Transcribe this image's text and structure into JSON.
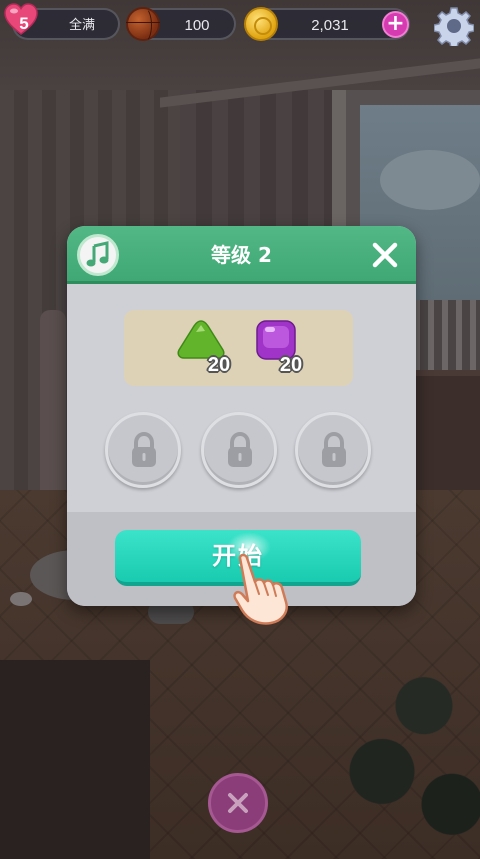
{
  "hud": {
    "lives": {
      "count": "5",
      "status": "全满",
      "icon": "heart-icon"
    },
    "balls": {
      "value": "100",
      "icon": "ball-icon"
    },
    "coins": {
      "value": "2,031",
      "icon": "coin-icon",
      "add_icon": "plus-icon"
    },
    "settings_icon": "gear-icon"
  },
  "dialog": {
    "title": "等级 2",
    "music_icon": "music-note-icon",
    "close_icon": "close-icon",
    "goals": [
      {
        "gem": "green-triangle-gem",
        "count": "20",
        "color": "#62b52a"
      },
      {
        "gem": "purple-square-gem",
        "count": "20",
        "color": "#a033c8"
      }
    ],
    "boosters": [
      {
        "state": "locked",
        "icon": "lock-icon"
      },
      {
        "state": "locked",
        "icon": "lock-icon"
      },
      {
        "state": "locked",
        "icon": "lock-icon"
      }
    ],
    "start_label": "开始",
    "accent_color": "#4bb37f",
    "button_color": "#2ad8bd"
  },
  "bottom_close_icon": "close-icon"
}
